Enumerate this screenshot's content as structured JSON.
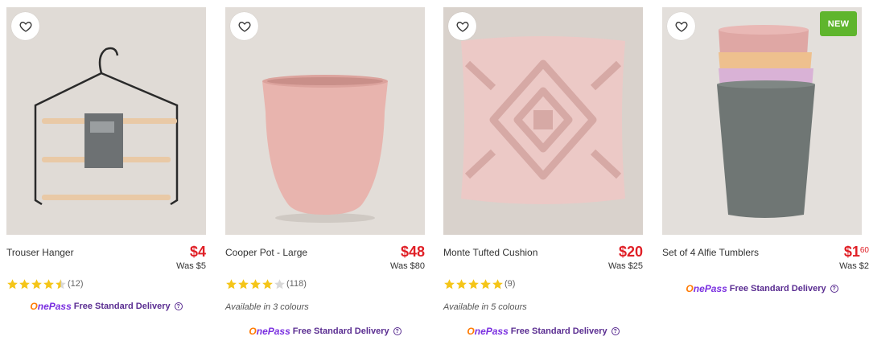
{
  "products": [
    {
      "title": "Trouser Hanger",
      "price_main": "$4",
      "price_cents": "",
      "was_price": "Was $5",
      "rating": 4.5,
      "review_count": "(12)",
      "colours_note": "",
      "delivery_brand": "OnePass",
      "delivery_text": "Free Standard Delivery",
      "badge": ""
    },
    {
      "title": "Cooper Pot - Large",
      "price_main": "$48",
      "price_cents": "",
      "was_price": "Was $80",
      "rating": 4.0,
      "review_count": "(118)",
      "colours_note": "Available in 3 colours",
      "delivery_brand": "OnePass",
      "delivery_text": "Free Standard Delivery",
      "badge": ""
    },
    {
      "title": "Monte Tufted Cushion",
      "price_main": "$20",
      "price_cents": "",
      "was_price": "Was $25",
      "rating": 5.0,
      "review_count": "(9)",
      "colours_note": "Available in 5 colours",
      "delivery_brand": "OnePass",
      "delivery_text": "Free Standard Delivery",
      "badge": ""
    },
    {
      "title": "Set of 4 Alfie Tumblers",
      "price_main": "$1",
      "price_cents": "60",
      "was_price": "Was $2",
      "rating": null,
      "review_count": "",
      "colours_note": "",
      "delivery_brand": "OnePass",
      "delivery_text": "Free Standard Delivery",
      "badge": "NEW"
    }
  ],
  "colors": {
    "price_red": "#e01f26",
    "star_gold": "#f5c518",
    "onepass_purple": "#5a2d91",
    "new_badge_green": "#5fb52d",
    "image_bg": "#e1dcd7"
  },
  "icons": {
    "wishlist": "heart-outline-icon",
    "help": "question-circle-icon",
    "star": "star-icon"
  }
}
